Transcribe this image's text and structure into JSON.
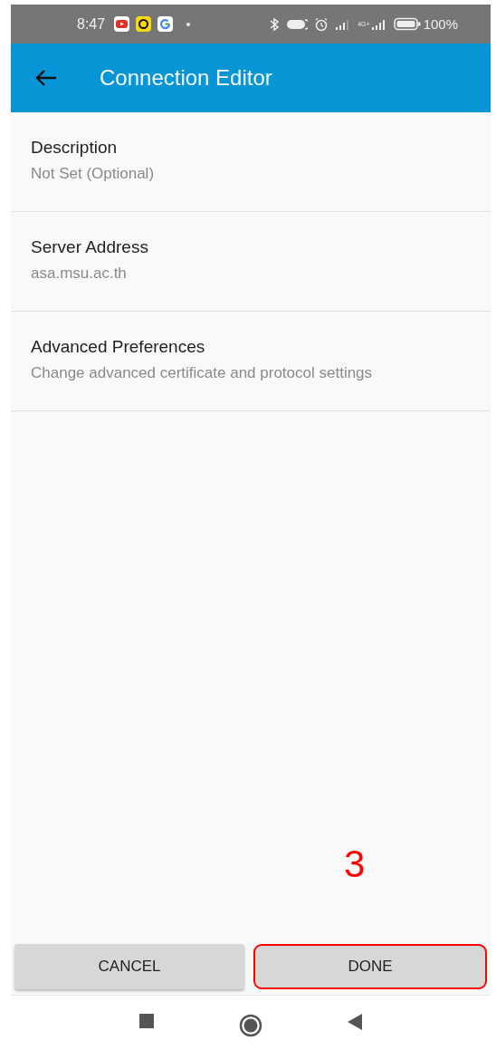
{
  "status_bar": {
    "time": "8:47",
    "network": "4G+",
    "battery": "100%"
  },
  "app_bar": {
    "title": "Connection Editor"
  },
  "preferences": [
    {
      "title": "Description",
      "summary": "Not Set (Optional)"
    },
    {
      "title": "Server Address",
      "summary": "asa.msu.ac.th"
    },
    {
      "title": "Advanced Preferences",
      "summary": "Change advanced certificate and protocol settings"
    }
  ],
  "annotation": {
    "label": "3"
  },
  "buttons": [
    {
      "label": "CANCEL",
      "highlighted": false
    },
    {
      "label": "DONE",
      "highlighted": true
    }
  ]
}
